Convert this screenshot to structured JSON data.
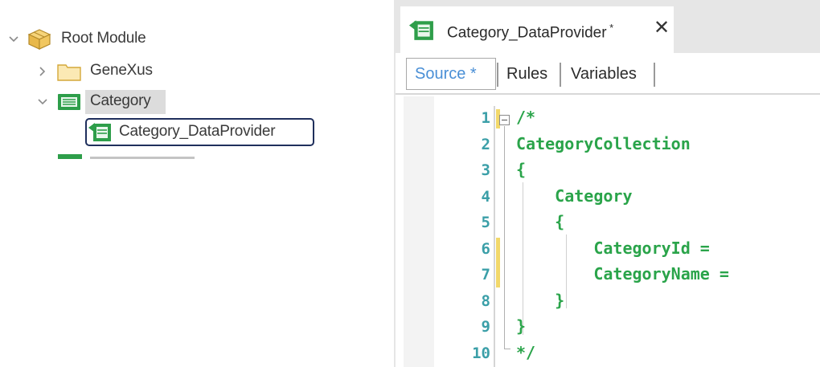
{
  "tree": {
    "nodes": [
      {
        "label": "Root Module",
        "icon": "cube-icon",
        "expanded": true
      },
      {
        "label": "GeneXus",
        "icon": "folder-icon",
        "expanded": false
      },
      {
        "label": "Category",
        "icon": "transaction-icon",
        "expanded": true,
        "selected": true
      },
      {
        "label": "Category_DataProvider",
        "icon": "data-provider-icon",
        "focused": true
      }
    ]
  },
  "editor": {
    "doc_tab": {
      "label": "Category_DataProvider",
      "close_icon": "close-icon",
      "icon": "data-provider-icon"
    },
    "subtabs": {
      "source": "Source *",
      "rules": "Rules",
      "variables": "Variables"
    },
    "lines": [
      {
        "num": "1",
        "text": "/*"
      },
      {
        "num": "2",
        "text": "CategoryCollection"
      },
      {
        "num": "3",
        "text": "{"
      },
      {
        "num": "4",
        "text": "    Category"
      },
      {
        "num": "5",
        "text": "    {"
      },
      {
        "num": "6",
        "text": "        CategoryId ="
      },
      {
        "num": "7",
        "text": "        CategoryName ="
      },
      {
        "num": "8",
        "text": "    }"
      },
      {
        "num": "9",
        "text": "}"
      },
      {
        "num": "10",
        "text": "*/"
      }
    ]
  },
  "colors": {
    "code_text": "#2aa44a",
    "line_numbers": "#3b9fa8",
    "active_subtab": "#4a8fd6",
    "focus_border": "#1f2f5c",
    "change_marker": "#f2d86a"
  }
}
